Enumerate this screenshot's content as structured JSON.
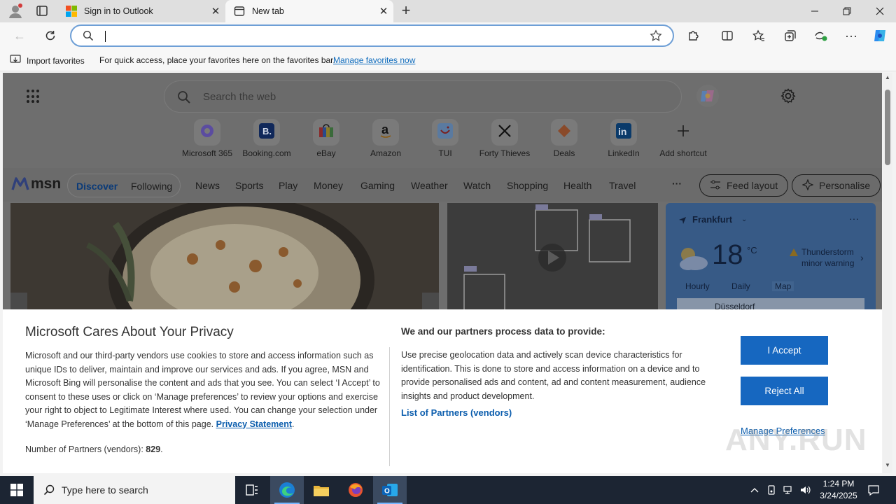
{
  "browser": {
    "tabs": [
      {
        "title": "Sign in to Outlook",
        "active": false,
        "favicon": "microsoft-logo-icon"
      },
      {
        "title": "New tab",
        "active": true,
        "favicon": "newtab-page-icon"
      }
    ],
    "address_value": "",
    "favorites_bar": {
      "import_label": "Import favorites",
      "message": "For quick access, place your favorites here on the favorites bar.",
      "manage_link": "Manage favorites now"
    }
  },
  "newtab": {
    "search_placeholder": "Search the web",
    "shortcuts": [
      {
        "label": "Microsoft 365"
      },
      {
        "label": "Booking.com"
      },
      {
        "label": "eBay"
      },
      {
        "label": "Amazon"
      },
      {
        "label": "TUI"
      },
      {
        "label": "Forty Thieves"
      },
      {
        "label": "Deals"
      },
      {
        "label": "LinkedIn"
      },
      {
        "label": "Add shortcut"
      }
    ],
    "msn": {
      "logo_text": "msn",
      "toggle": {
        "discover": "Discover",
        "following": "Following"
      },
      "categories": [
        "News",
        "Sports",
        "Play",
        "Money",
        "Gaming",
        "Weather",
        "Watch",
        "Shopping",
        "Health",
        "Travel"
      ],
      "feed_layout": "Feed layout",
      "personalise": "Personalise"
    },
    "weather": {
      "city": "Frankfurt",
      "temp": "18",
      "unit": "°C",
      "warning_line1": "Thunderstorm",
      "warning_line2": "minor warning",
      "tabs": [
        "Hourly",
        "Daily",
        "Map"
      ],
      "map_label": "Düsseldorf"
    }
  },
  "consent": {
    "title": "Microsoft Cares About Your Privacy",
    "body": "Microsoft and our third-party vendors use cookies to store and access information such as unique IDs to deliver, maintain and improve our services and ads. If you agree, MSN and Microsoft Bing will personalise the content and ads that you see. You can select ‘I Accept’ to consent to these uses or click on ‘Manage preferences’ to review your options and exercise your right to object to Legitimate Interest where used.  You can change your selection under ‘Manage Preferences’ at the bottom of this page.",
    "privacy_link": "Privacy Statement",
    "partners_label": "Number of Partners (vendors):",
    "partners_count": "829",
    "right_title": "We and our partners process data to provide:",
    "right_body": "Use precise geolocation data and actively scan device characteristics for identification. This is done to store and access information on a device and to provide personalised ads and content, ad and content measurement, audience insights and product development.",
    "list_partners": "List of Partners (vendors)",
    "accept": "I Accept",
    "reject": "Reject All",
    "manage": "Manage Preferences"
  },
  "watermark": "ANY.RUN",
  "taskbar": {
    "search_placeholder": "Type here to search",
    "time": "1:24 PM",
    "date": "3/24/2025"
  },
  "colors": {
    "accent": "#1667c0",
    "link": "#0b5dad",
    "taskbar": "#1c2533"
  }
}
